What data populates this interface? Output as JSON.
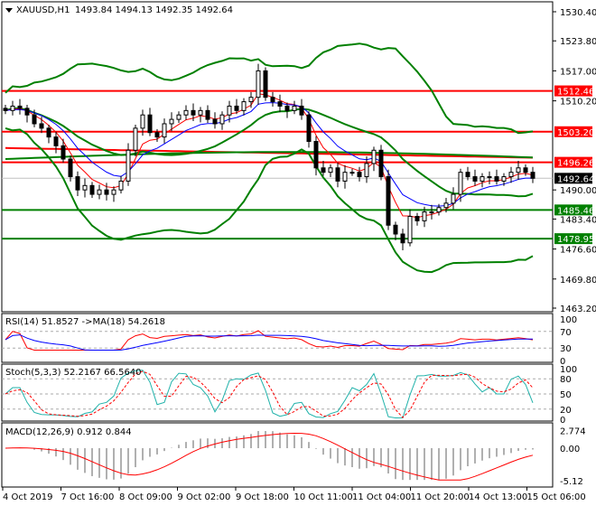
{
  "header": {
    "symbol": "XAUUSD,H1",
    "ohlc": "1493.84 1494.13 1492.35 1492.64"
  },
  "colors": {
    "bull": "#000000",
    "bear": "#000000",
    "support": "#008000",
    "resistance": "#ff0000",
    "ma_fast_red": "#ff0000",
    "ma_fast_blue": "#0000ff",
    "bands": "#008000"
  },
  "chart_data": [
    {
      "type": "candlestick",
      "title": "XAUUSD,H1",
      "closes": [
        1508,
        1509,
        1508.5,
        1507,
        1505,
        1504,
        1502,
        1500,
        1497,
        1493,
        1490,
        1491,
        1489,
        1490,
        1489,
        1490,
        1492,
        1499,
        1504,
        1507,
        1503,
        1502,
        1505,
        1506,
        1507,
        1508,
        1507,
        1508,
        1506,
        1505,
        1507,
        1509,
        1508,
        1510,
        1511,
        1517,
        1511,
        1510,
        1509,
        1508,
        1509,
        1507,
        1501,
        1495,
        1494,
        1495,
        1492,
        1494,
        1494,
        1493,
        1496,
        1499,
        1493,
        1482,
        1480,
        1478,
        1484,
        1483,
        1485,
        1485,
        1486,
        1487,
        1489,
        1494,
        1493,
        1492,
        1493,
        1493,
        1492,
        1493,
        1494,
        1495,
        1494,
        1492.64
      ],
      "ylim": [
        1463.2,
        1530.4
      ],
      "y_ticks": [
        "1530.40",
        "1523.80",
        "1517.00",
        "1510.20",
        "1490.00",
        "1483.40",
        "1476.60",
        "1469.80",
        "1463.20"
      ],
      "levels": [
        {
          "label": "1512.46",
          "value": 1512.46,
          "kind": "resistance"
        },
        {
          "label": "1503.20",
          "value": 1503.2,
          "kind": "resistance"
        },
        {
          "label": "1496.26",
          "value": 1496.26,
          "kind": "resistance"
        },
        {
          "label": "1485.46",
          "value": 1485.46,
          "kind": "support"
        },
        {
          "label": "1478.95",
          "value": 1478.95,
          "kind": "support"
        }
      ],
      "current_price": {
        "label": "1492.64",
        "value": 1492.64
      },
      "x_labels": [
        "4 Oct 2019",
        "7 Oct 16:00",
        "8 Oct 09:00",
        "9 Oct 02:00",
        "9 Oct 18:00",
        "10 Oct 11:00",
        "11 Oct 04:00",
        "11 Oct 20:00",
        "14 Oct 13:00",
        "15 Oct 06:00"
      ]
    },
    {
      "type": "line",
      "title": "RSI(14) 51.8527  ->MA(18) 54.2618",
      "y_ticks": [
        "100",
        "70",
        "30",
        "0"
      ],
      "ylim": [
        0,
        100
      ]
    },
    {
      "type": "line",
      "title": "Stoch(5,3,3) 52.2167 66.5640",
      "y_ticks": [
        "100",
        "80",
        "50",
        "20",
        "0"
      ],
      "ylim": [
        0,
        100
      ]
    },
    {
      "type": "bar",
      "title": "MACD(12,26,9) 0.912 0.844",
      "y_ticks": [
        "2.774",
        "0.00",
        "-5.12"
      ],
      "ylim": [
        -5.12,
        2.774
      ]
    }
  ]
}
